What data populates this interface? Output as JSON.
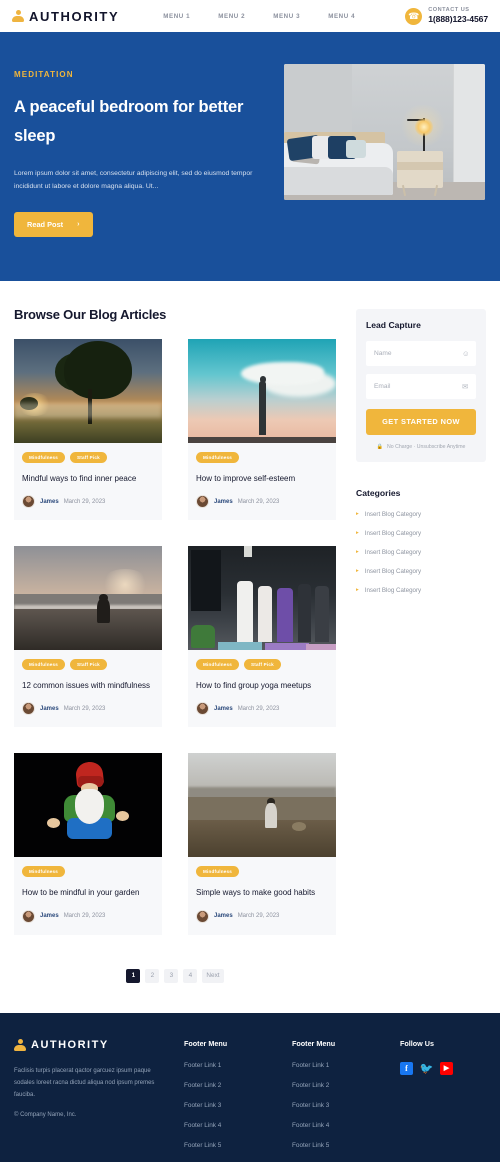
{
  "header": {
    "brand": "AUTHORITY",
    "nav": [
      {
        "label": "MENU 1"
      },
      {
        "label": "MENU 2"
      },
      {
        "label": "MENU 3"
      },
      {
        "label": "MENU 4"
      }
    ],
    "contact_label": "CONTACT US",
    "contact_phone": "1(888)123-4567",
    "phone_icon": "phone-icon",
    "logo_icon": "person-badge-icon"
  },
  "hero": {
    "eyebrow": "MEDITATION",
    "title": "A peaceful bedroom for better sleep",
    "description": "Lorem ipsum dolor sit amet, consectetur adipiscing elit, sed do eiusmod tempor incididunt ut labore et dolore magna aliqua. Ut...",
    "button": "Read Post",
    "button_chevron": "›",
    "image_alt": "bedroom-photo",
    "bg_color": "#19509b",
    "accent_color": "#f0b63c"
  },
  "main": {
    "section_title": "Browse Our Blog Articles",
    "posts": [
      {
        "image": "tree-in-field-photo",
        "tags": [
          "Mindfulness",
          "Staff Pick"
        ],
        "title": "Mindful ways to find inner peace",
        "author": "James",
        "date": "March 29, 2023"
      },
      {
        "image": "person-silhouette-sky-photo",
        "tags": [
          "Mindfulness"
        ],
        "title": "How to improve self-esteem",
        "author": "James",
        "date": "March 29, 2023"
      },
      {
        "image": "beach-meditation-photo",
        "tags": [
          "Mindfulness",
          "Staff Pick"
        ],
        "title": "12 common issues with mindfulness",
        "author": "James",
        "date": "March 29, 2023"
      },
      {
        "image": "yoga-class-photo",
        "tags": [
          "Mindfulness",
          "Staff Pick"
        ],
        "title": "How to find group yoga meetups",
        "author": "James",
        "date": "March 29, 2023"
      },
      {
        "image": "meditating-gnome-photo",
        "tags": [
          "Mindfulness"
        ],
        "title": "How to be mindful in your garden",
        "author": "James",
        "date": "March 29, 2023"
      },
      {
        "image": "mountain-meditation-photo",
        "tags": [
          "Mindfulness"
        ],
        "title": "Simple ways to make good habits",
        "author": "James",
        "date": "March 29, 2023"
      }
    ],
    "pagination": [
      {
        "label": "1",
        "active": true
      },
      {
        "label": "2",
        "active": false
      },
      {
        "label": "3",
        "active": false
      },
      {
        "label": "4",
        "active": false
      },
      {
        "label": "Next",
        "active": false
      }
    ]
  },
  "sidebar": {
    "lead_capture": {
      "title": "Lead Capture",
      "name_placeholder": "Name",
      "name_value": "",
      "name_icon": "user-icon",
      "email_placeholder": "Email",
      "email_value": "",
      "email_icon": "envelope-icon",
      "cta": "GET STARTED NOW",
      "note": "No Charge · Unsubscribe Anytime",
      "note_icon": "lock-icon"
    },
    "categories": {
      "title": "Categories",
      "items": [
        "Insert Blog Category",
        "Insert Blog Category",
        "Insert Blog Category",
        "Insert Blog Category",
        "Insert Blog Category"
      ],
      "bullet_icon": "chevron-right-icon"
    }
  },
  "footer": {
    "brand": "AUTHORITY",
    "logo_icon": "person-badge-icon",
    "description": "Faclisis turpis placerat qactor garcuez ipsum paque sodales loreet racna dictud aliqua nod ipsum premes fauciba.",
    "copyright": "© Company Name, Inc.",
    "columns": [
      {
        "heading": "Footer Menu",
        "links": [
          "Footer Link 1",
          "Footer Link 2",
          "Footer Link 3",
          "Footer Link 4",
          "Footer Link 5"
        ]
      },
      {
        "heading": "Footer Menu",
        "links": [
          "Footer Link 1",
          "Footer Link 2",
          "Footer Link 3",
          "Footer Link 4",
          "Footer Link 5"
        ]
      }
    ],
    "social": {
      "heading": "Follow Us",
      "items": [
        {
          "name": "facebook-icon",
          "glyph": "f",
          "color": "#1877f2"
        },
        {
          "name": "twitter-icon",
          "glyph": "🐦",
          "color": "#1d9bf0"
        },
        {
          "name": "youtube-icon",
          "glyph": "▶",
          "color": "#ff0000"
        }
      ]
    },
    "bg_color": "#0e2240"
  }
}
